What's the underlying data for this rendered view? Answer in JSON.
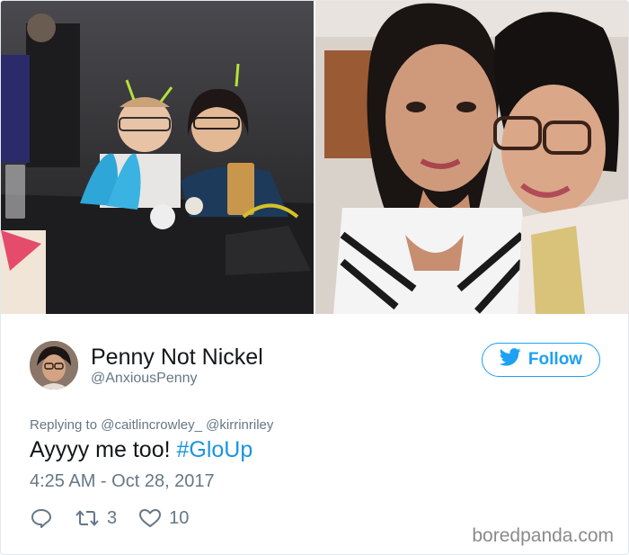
{
  "tweet": {
    "author_name": "Penny Not Nickel",
    "author_handle": "@AnxiousPenny",
    "follow_label": "Follow",
    "replying_prefix": "Replying to",
    "reply_mentions": [
      "@caitlincrowley_",
      "@kirrinriley"
    ],
    "text": "Ayyyy me too!",
    "hashtag": "#GloUp",
    "timestamp": "4:25 AM - Oct 28, 2017",
    "retweets": "3",
    "likes": "10"
  },
  "icons": {
    "reply": "reply-icon",
    "retweet": "retweet-icon",
    "like": "heart-icon",
    "twitter": "twitter-bird-icon"
  },
  "colors": {
    "accent": "#1da1f2",
    "hashtag": "#1b95e0",
    "muted": "#657786",
    "text": "#14171a"
  },
  "watermark": "boredpanda.com"
}
